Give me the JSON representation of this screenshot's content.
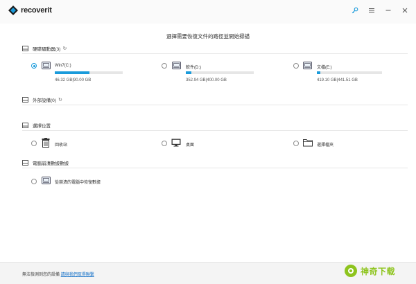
{
  "app": {
    "name": "recoverit",
    "brand_color": "#1a9bdb"
  },
  "window_controls": [
    {
      "icon": "key-icon"
    },
    {
      "icon": "menu-icon"
    },
    {
      "icon": "minimize-icon"
    },
    {
      "icon": "close-icon"
    }
  ],
  "instruction": "選擇需要恢復文件的路徑並開始掃描",
  "sections": {
    "hard_drives": {
      "title": "硬碟驅動器(3)",
      "drives": [
        {
          "name": "Win7(C:)",
          "size": "46.32  GB|90.00  GB",
          "used_fraction": 0.51,
          "selected": true
        },
        {
          "name": "軟件(D:)",
          "size": "352.94  GB|400.00 GB",
          "used_fraction": 0.08,
          "selected": false
        },
        {
          "name": "文檔(E:)",
          "size": "419.10  GB|441.51  GB",
          "used_fraction": 0.05,
          "selected": false
        }
      ]
    },
    "external_devices": {
      "title": "外部設備(0)"
    },
    "select_location": {
      "title": "選擇位置",
      "items": [
        {
          "label": "回收站",
          "icon": "recycle-bin-icon"
        },
        {
          "label": "桌面",
          "icon": "desktop-icon"
        },
        {
          "label": "選擇檔夾",
          "icon": "folder-icon"
        }
      ]
    },
    "crashed_computer": {
      "title": "電腦崩潰數據數據",
      "item": {
        "label": "從崩潰的電腦中恢復數據",
        "icon": "crashed-drive-icon"
      }
    }
  },
  "footer": {
    "text": "無法檢測到您的設備",
    "link": "請與我們取得聯繫"
  },
  "watermark": {
    "text": "神奇下载",
    "color": "#8ec41e"
  }
}
